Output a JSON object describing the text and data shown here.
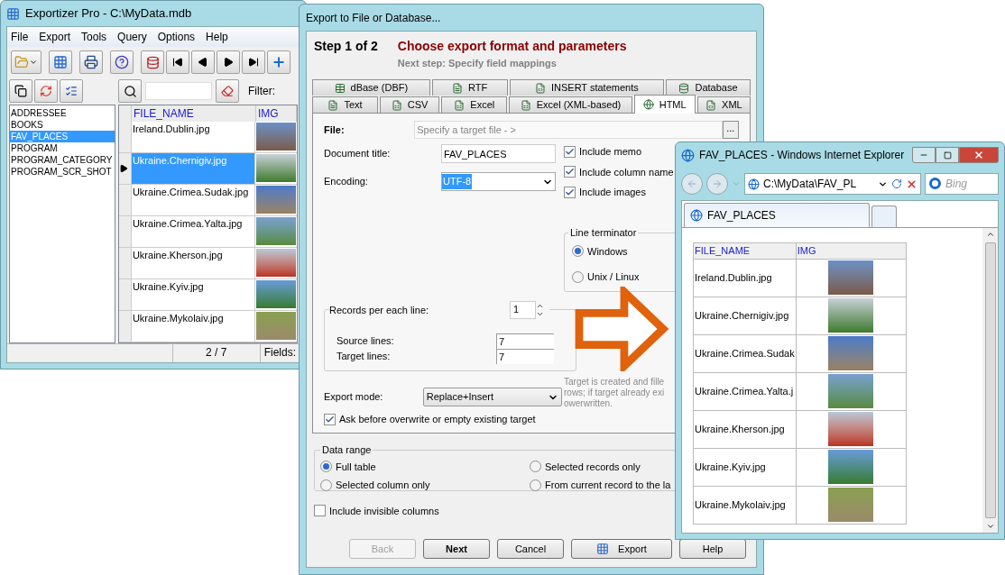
{
  "main_window": {
    "title": "Exportizer Pro - C:\\MyData.mdb",
    "menu": [
      "File",
      "Export",
      "Tools",
      "Query",
      "Options",
      "Help"
    ],
    "tables": [
      {
        "label": "ADDRESSEE",
        "selected": false
      },
      {
        "label": "BOOKS",
        "selected": false
      },
      {
        "label": "FAV_PLACES",
        "selected": true
      },
      {
        "label": "PROGRAM",
        "selected": false
      },
      {
        "label": "PROGRAM_CATEGORY",
        "selected": false
      },
      {
        "label": "PROGRAM_SCR_SHOT",
        "selected": false
      }
    ],
    "filter_label": "Filter:",
    "grid": {
      "columns": [
        "FILE_NAME",
        "IMG"
      ],
      "rows": [
        {
          "file_name": "Ireland.Dublin.jpg",
          "selected": false
        },
        {
          "file_name": "Ukraine.Chernigiv.jpg",
          "selected": true
        },
        {
          "file_name": "Ukraine.Crimea.Sudak.jpg",
          "selected": false
        },
        {
          "file_name": "Ukraine.Crimea.Yalta.jpg",
          "selected": false
        },
        {
          "file_name": "Ukraine.Kherson.jpg",
          "selected": false
        },
        {
          "file_name": "Ukraine.Kyiv.jpg",
          "selected": false
        },
        {
          "file_name": "Ukraine.Mykolaiv.jpg",
          "selected": false
        }
      ]
    },
    "status": {
      "position": "2 / 7",
      "fields": "Fields:"
    }
  },
  "export_dialog": {
    "title": "Export to File or Database...",
    "step": "Step 1 of 2",
    "heading": "Choose export format and parameters",
    "next_step": "Next step: Specify field mappings",
    "tab_rows": [
      [
        {
          "label": "dBase (DBF)",
          "selected": false
        },
        {
          "label": "RTF",
          "selected": false
        },
        {
          "label": "INSERT statements",
          "selected": false
        },
        {
          "label": "Database",
          "selected": false
        }
      ],
      [
        {
          "label": "Text",
          "selected": false
        },
        {
          "label": "CSV",
          "selected": false
        },
        {
          "label": "Excel",
          "selected": false
        },
        {
          "label": "Excel (XML-based)",
          "selected": false
        },
        {
          "label": "HTML",
          "selected": true
        },
        {
          "label": "XML",
          "selected": false
        }
      ]
    ],
    "file": {
      "label": "File:",
      "placeholder": "Specify a target file - >",
      "browse": "..."
    },
    "document_title": {
      "label": "Document title:",
      "value": "FAV_PLACES"
    },
    "encoding": {
      "label": "Encoding:",
      "value": "UTF-8"
    },
    "options": [
      {
        "label": "Include memo",
        "checked": true
      },
      {
        "label": "Include column name",
        "checked": true
      },
      {
        "label": "Include images",
        "checked": true
      }
    ],
    "line_terminator": {
      "title": "Line terminator",
      "choices": [
        {
          "label": "Windows",
          "selected": true
        },
        {
          "label": "Unix / Linux",
          "selected": false
        }
      ]
    },
    "records": {
      "label": "Records per each line:",
      "value": "1",
      "source_label": "Source lines:",
      "source_value": "7",
      "target_label": "Target lines:",
      "target_value": "7"
    },
    "note_lines": [
      "Target is created and fille",
      "rows; if target already exi",
      "owerwritten."
    ],
    "export_mode": {
      "label": "Export mode:",
      "value": "Replace+Insert"
    },
    "ask_overwrite": {
      "label": "Ask before overwrite or empty existing target",
      "checked": true
    },
    "data_range": {
      "title": "Data range",
      "choices": [
        {
          "label": "Full table",
          "selected": true
        },
        {
          "label": "Selected records only",
          "selected": false
        },
        {
          "label": "Selected column only",
          "selected": false
        },
        {
          "label": "From current record to the la",
          "selected": false
        }
      ]
    },
    "include_invisible": {
      "label": "Include invisible columns",
      "checked": false
    },
    "buttons": [
      {
        "label": "Back",
        "kind": "plain",
        "disabled": true,
        "default": false
      },
      {
        "label": "Next",
        "kind": "plain",
        "disabled": false,
        "default": true
      },
      {
        "label": "Cancel",
        "kind": "plain",
        "disabled": false,
        "default": false
      },
      {
        "label": "Export",
        "kind": "export",
        "disabled": false,
        "default": false
      },
      {
        "label": "Help",
        "kind": "plain",
        "disabled": false,
        "default": false
      }
    ]
  },
  "ie_window": {
    "title": "FAV_PLACES - Windows Internet Explorer",
    "address": "C:\\MyData\\FAV_PL",
    "search_placeholder": "Bing",
    "tab": {
      "label": "FAV_PLACES",
      "selected": true
    },
    "table": {
      "columns": [
        "FILE_NAME",
        "IMG"
      ],
      "rows": [
        "Ireland.Dublin.jpg",
        "Ukraine.Chernigiv.jpg",
        "Ukraine.Crimea.Sudak",
        "Ukraine.Crimea.Yalta.j",
        "Ukraine.Kherson.jpg",
        "Ukraine.Kyiv.jpg",
        "Ukraine.Mykolaiv.jpg"
      ]
    }
  }
}
